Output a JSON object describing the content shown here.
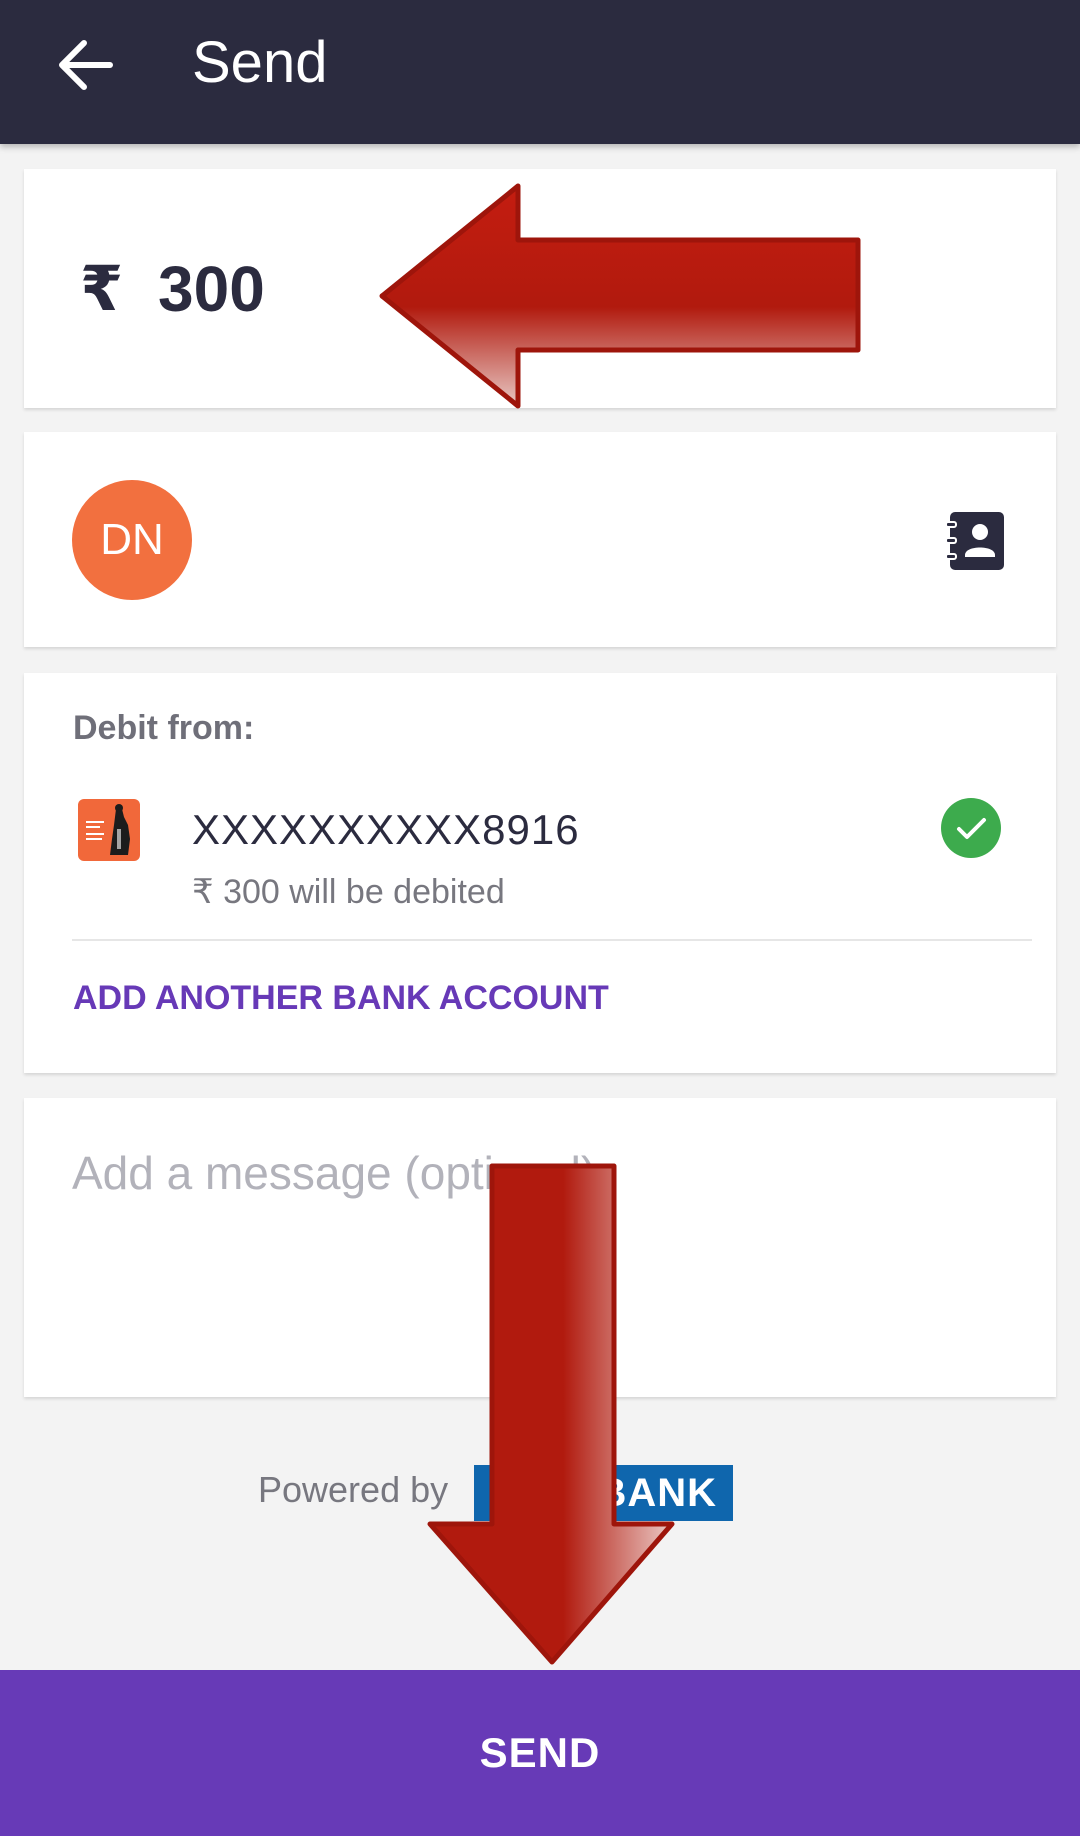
{
  "app_bar": {
    "title": "Send",
    "back_icon": "arrow-back-icon"
  },
  "amount": {
    "currency_symbol": "₹",
    "value": "300"
  },
  "recipient": {
    "initials": "DN",
    "avatar_color": "#f2703f",
    "contacts_icon": "contact-book-icon"
  },
  "debit": {
    "label": "Debit from:",
    "account_number": "XXXXXXXXXX8916",
    "note": "₹ 300 will be debited",
    "selected_icon": "check-circle-icon",
    "add_account_label": "ADD ANOTHER BANK ACCOUNT"
  },
  "message": {
    "placeholder": "Add a message (optional)",
    "value": ""
  },
  "footer": {
    "powered_by": "Powered by",
    "bank_name": "BANK"
  },
  "send_button": {
    "label": "SEND"
  },
  "colors": {
    "app_bar": "#2b2b3f",
    "accent": "#6739b7",
    "success": "#3dab4d",
    "annotation_arrow": "#b01a0e"
  }
}
